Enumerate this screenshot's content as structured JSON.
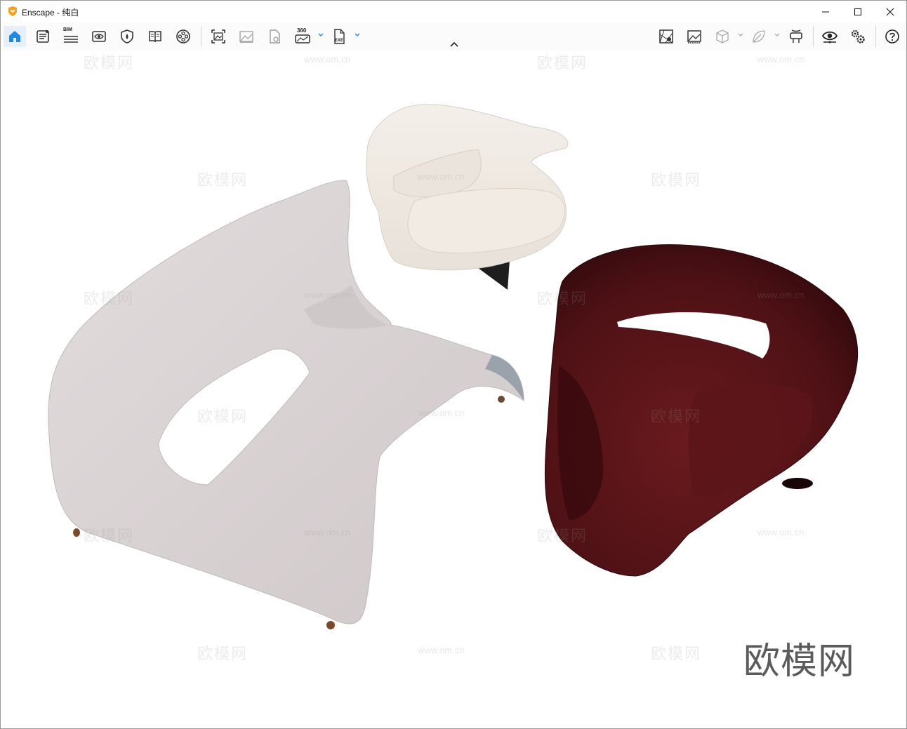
{
  "window": {
    "app_name": "Enscape",
    "title_separator": " - ",
    "document_name": "纯白",
    "accent_color": "#f4a11d",
    "controls": [
      "minimize-icon",
      "maximize-icon",
      "close-icon"
    ]
  },
  "toolbar": {
    "left_tools": [
      {
        "name": "home",
        "icon": "home-icon",
        "active": true
      },
      {
        "name": "asset-library",
        "icon": "asset-library-icon"
      },
      {
        "name": "bim",
        "icon": "bim-icon",
        "label": "BIM"
      },
      {
        "name": "views",
        "icon": "view-eye-icon"
      },
      {
        "name": "materials",
        "icon": "material-shield-icon"
      },
      {
        "name": "bookmarks",
        "icon": "book-icon"
      },
      {
        "name": "video",
        "icon": "video-reel-icon"
      },
      {
        "name": "screenshot",
        "icon": "screenshot-icon"
      },
      {
        "name": "batch-render",
        "icon": "batch-render-icon"
      },
      {
        "name": "export-file",
        "icon": "export-file-icon"
      },
      {
        "name": "panorama",
        "icon": "panorama-360-icon",
        "label": "360"
      },
      {
        "name": "exe-export",
        "icon": "exe-export-icon",
        "label": "EXE"
      }
    ],
    "right_tools": [
      {
        "name": "map",
        "icon": "map-icon"
      },
      {
        "name": "gallery",
        "icon": "gallery-icon"
      },
      {
        "name": "cube",
        "icon": "cube-icon"
      },
      {
        "name": "leaf",
        "icon": "leaf-icon"
      },
      {
        "name": "vr-headset",
        "icon": "vr-headset-icon"
      },
      {
        "name": "visual-settings",
        "icon": "visual-settings-eye-icon"
      },
      {
        "name": "settings",
        "icon": "gears-icon"
      },
      {
        "name": "help",
        "icon": "help-icon"
      }
    ]
  },
  "viewport": {
    "background": "#ffffff",
    "objects": [
      "white-lounge-chair",
      "cream-armchair",
      "burgundy-armchair"
    ],
    "watermark_text": "欧模网",
    "watermark_url": "www.om.cn",
    "brand_text": "欧模网"
  }
}
